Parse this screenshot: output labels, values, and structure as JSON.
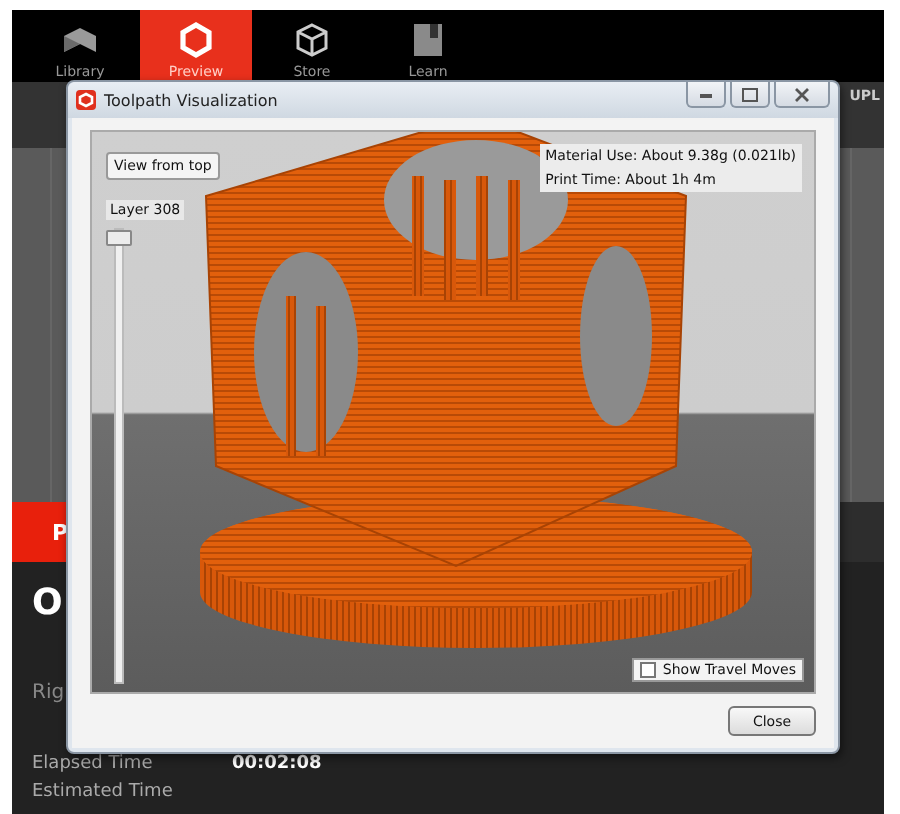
{
  "app": {
    "tabs": [
      {
        "label": "Library",
        "selected": false
      },
      {
        "label": "Preview",
        "selected": true
      },
      {
        "label": "Store",
        "selected": false
      },
      {
        "label": "Learn",
        "selected": false
      }
    ],
    "upload_label": "UPL",
    "panel_tab": "P",
    "heading": "O",
    "subtitle": "Rig",
    "stats": [
      {
        "label": "Elapsed Time",
        "value": "00:02:08"
      },
      {
        "label": "Estimated Time"
      }
    ]
  },
  "dialog": {
    "title": "Toolpath Visualization",
    "view_button": "View from top",
    "layer": {
      "label": "Layer 308",
      "level": 1
    },
    "info": [
      "Material Use: About 9.38g (0.021lb)",
      "Print Time: About 1h 4m"
    ],
    "travel_moves": {
      "label": "Show Travel Moves",
      "checked": false
    },
    "close_button": "Close"
  }
}
